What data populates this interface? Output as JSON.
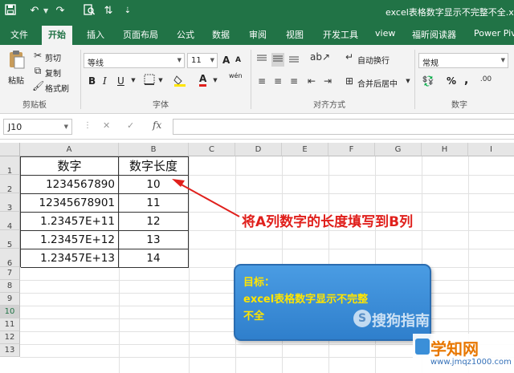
{
  "window": {
    "title": "excel表格数字显示不完整不全.xlsx",
    "accent": "#217346",
    "quick_access": [
      "save-icon",
      "undo-icon",
      "redo-icon",
      "print-preview-icon",
      "sort-icon",
      "customize-icon"
    ]
  },
  "tabs": [
    "文件",
    "开始",
    "插入",
    "页面布局",
    "公式",
    "数据",
    "审阅",
    "视图",
    "开发工具",
    "view",
    "福昕阅读器",
    "Power Pivot"
  ],
  "active_tab": "开始",
  "ribbon": {
    "clipboard": {
      "paste": "粘贴",
      "cut": "剪切",
      "copy": "复制",
      "format_painter": "格式刷",
      "label": "剪贴板"
    },
    "font": {
      "name": "等线",
      "size": "11",
      "label": "字体",
      "bold": "B",
      "italic": "I",
      "underline": "U",
      "grow": "A",
      "shrink": "A",
      "font_color": "A",
      "phonetic": "wén"
    },
    "alignment": {
      "wrap": "自动换行",
      "merge": "合并后居中",
      "label": "对齐方式"
    },
    "number": {
      "format": "常规",
      "percent": "%",
      "comma": ",",
      "label": "数字"
    }
  },
  "formula_bar": {
    "name_box": "J10",
    "fx": "fx",
    "cancel": "✕",
    "enter": "✓"
  },
  "grid": {
    "columns": [
      "A",
      "B",
      "C",
      "D",
      "E",
      "F",
      "G",
      "H",
      "I"
    ],
    "rows": [
      "1",
      "2",
      "3",
      "4",
      "5",
      "6",
      "7",
      "8",
      "9",
      "10",
      "11",
      "12",
      "13"
    ],
    "header": {
      "a": "数字",
      "b": "数字长度"
    },
    "data": [
      {
        "a": "1234567890",
        "b": "10"
      },
      {
        "a": "12345678901",
        "b": "11"
      },
      {
        "a": "1.23457E+11",
        "b": "12"
      },
      {
        "a": "1.23457E+12",
        "b": "13"
      },
      {
        "a": "1.23457E+13",
        "b": "14"
      }
    ]
  },
  "annotation": "将A列数字的长度填写到B列",
  "goal_box": {
    "line1": "目标：",
    "line2": "excel表格数字显示不完整",
    "line3": "不全"
  },
  "watermarks": {
    "sogou_mark": "S",
    "sogou": "搜狗指南",
    "site_name": "学知网",
    "site_url": "www.jmqz1000.com"
  }
}
